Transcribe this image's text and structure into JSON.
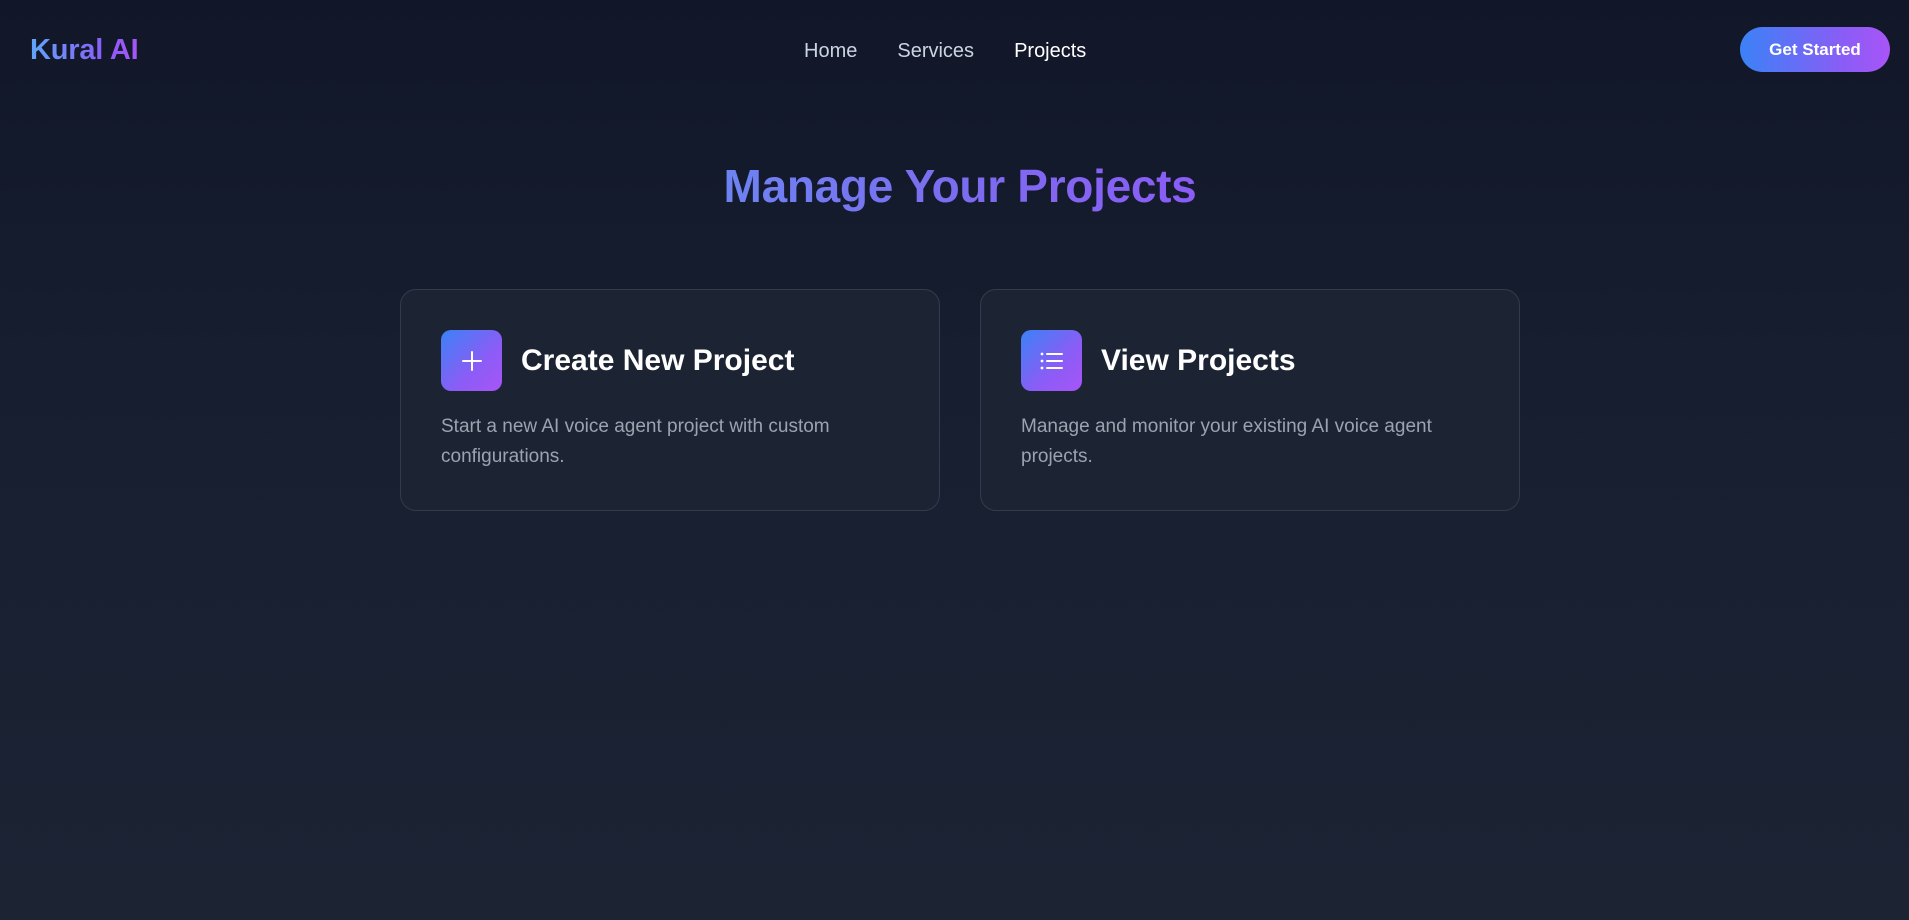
{
  "app": {
    "name": "Kural AI"
  },
  "nav": {
    "items": [
      {
        "label": "Home"
      },
      {
        "label": "Services"
      },
      {
        "label": "Projects"
      }
    ],
    "cta_label": "Get Started"
  },
  "main": {
    "title": "Manage Your Projects",
    "cards": [
      {
        "icon": "plus-icon",
        "title": "Create New Project",
        "description": "Start a new AI voice agent project with custom configurations."
      },
      {
        "icon": "list-icon",
        "title": "View Projects",
        "description": "Manage and monitor your existing AI voice agent projects."
      }
    ]
  },
  "colors": {
    "background": "#111729",
    "card_background": "#1c2434",
    "accent_start": "#3b82f6",
    "accent_end": "#a855f7"
  }
}
